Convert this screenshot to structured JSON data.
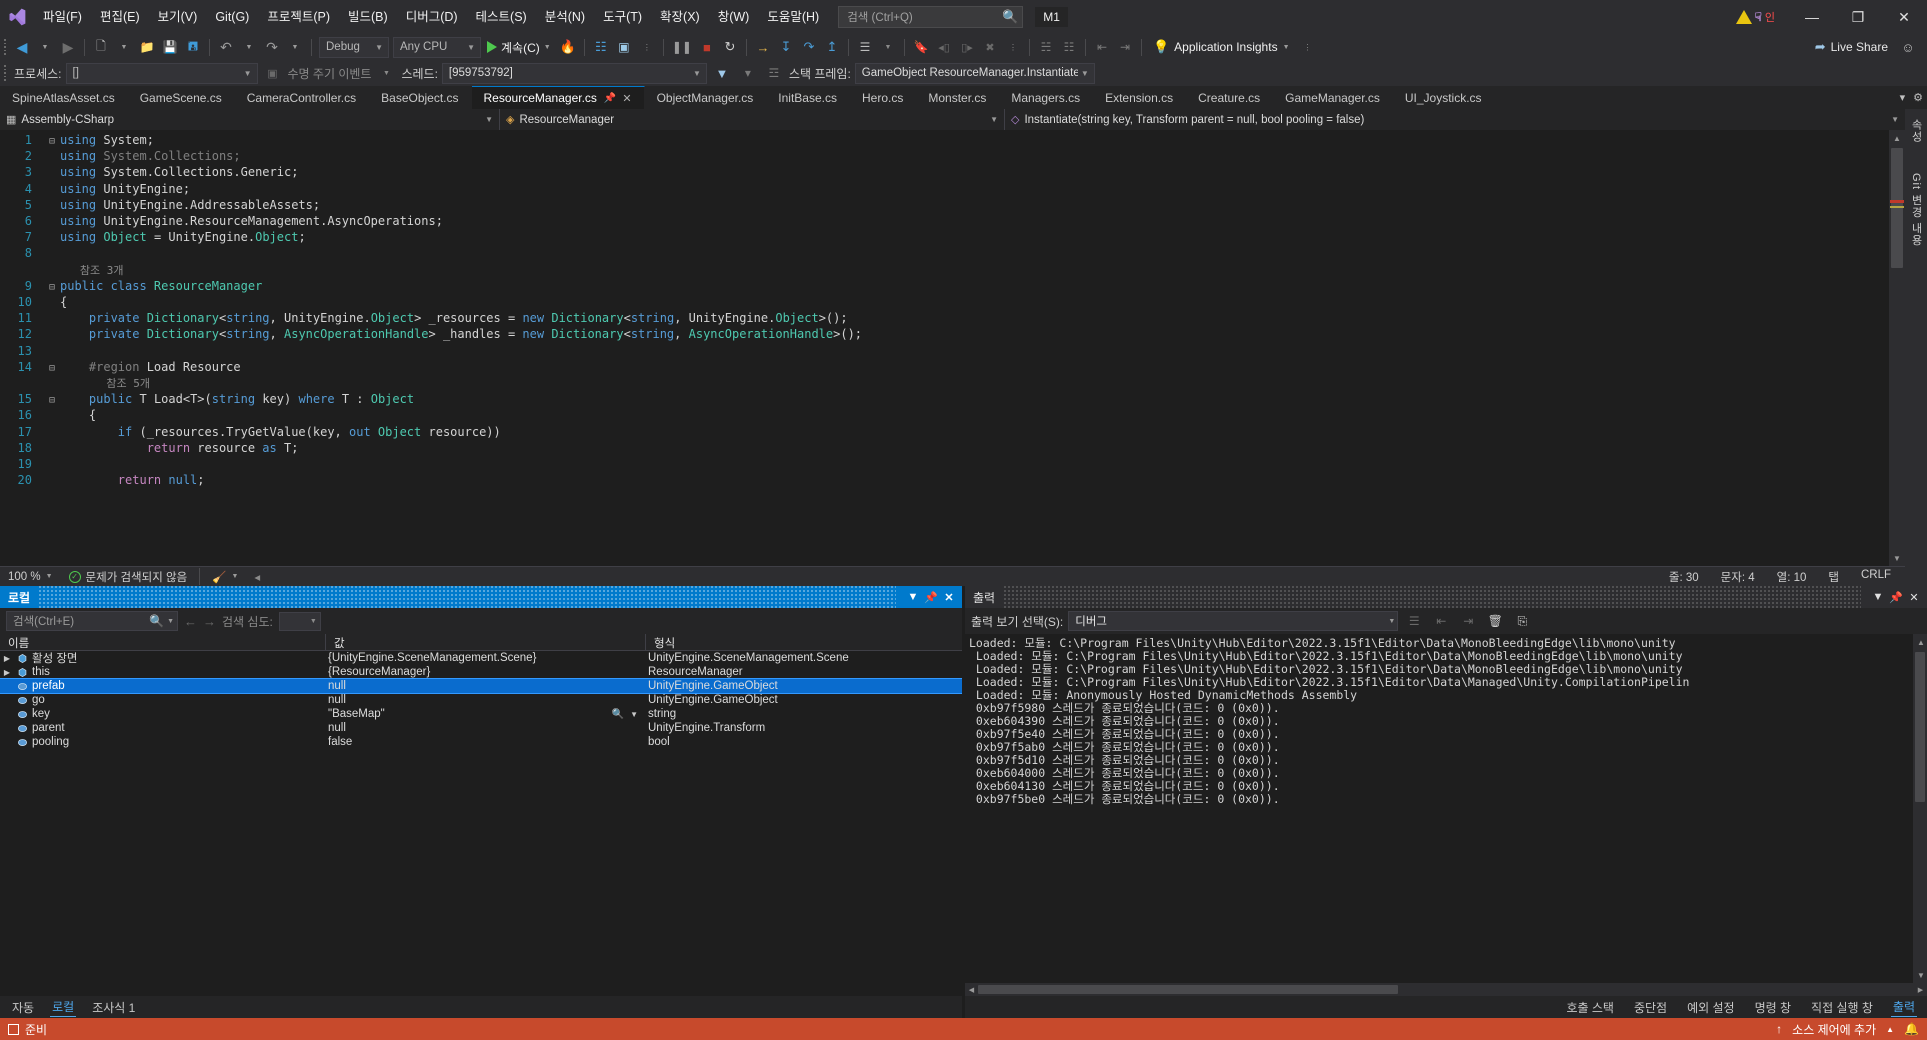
{
  "titlebar": {
    "menus": [
      "파일(F)",
      "편집(E)",
      "보기(V)",
      "Git(G)",
      "프로젝트(P)",
      "빌드(B)",
      "디버그(D)",
      "테스트(S)",
      "분석(N)",
      "도구(T)",
      "확장(X)",
      "창(W)",
      "도움말(H)"
    ],
    "search_placeholder": "검색 (Ctrl+Q)",
    "solution_name": "M1",
    "account_initial": "인",
    "minimize": "—",
    "restore": "❐",
    "close": "✕"
  },
  "toolbar": {
    "back": "◀",
    "forward": "▶",
    "new_item": "新",
    "open": "📂",
    "save": "💾",
    "save_all": "🗇",
    "undo": "↶",
    "redo": "↷",
    "config": "Debug",
    "platform": "Any CPU",
    "run_label": "계속(C)",
    "hot_reload": "🔥",
    "attach": "⛶",
    "screenshot": "◰",
    "pause": "❙❙",
    "stop": "■",
    "restart": "↺",
    "step_over": "→",
    "step_into": "↓",
    "step_out": "↑",
    "show_next": "⇥",
    "threads": "⚏",
    "bookmark": "🔖",
    "insights_label": "Application Insights",
    "live_share": "Live Share"
  },
  "debugbar": {
    "process_label": "프로세스:",
    "process_value": "[]",
    "lifecycle_label": "수명 주기 이벤트",
    "thread_label": "스레드:",
    "thread_value": "[959753792]",
    "stackframe_label": "스택 프레임:",
    "stackframe_value": "GameObject ResourceManager.Instantiate"
  },
  "tabs": [
    {
      "label": "SpineAtlasAsset.cs",
      "active": false
    },
    {
      "label": "GameScene.cs",
      "active": false
    },
    {
      "label": "CameraController.cs",
      "active": false
    },
    {
      "label": "BaseObject.cs",
      "active": false
    },
    {
      "label": "ResourceManager.cs",
      "active": true
    },
    {
      "label": "ObjectManager.cs",
      "active": false
    },
    {
      "label": "InitBase.cs",
      "active": false
    },
    {
      "label": "Hero.cs",
      "active": false
    },
    {
      "label": "Monster.cs",
      "active": false
    },
    {
      "label": "Managers.cs",
      "active": false
    },
    {
      "label": "Extension.cs",
      "active": false
    },
    {
      "label": "Creature.cs",
      "active": false
    },
    {
      "label": "GameManager.cs",
      "active": false
    },
    {
      "label": "UI_Joystick.cs",
      "active": false
    }
  ],
  "navbar": {
    "project": "Assembly-CSharp",
    "type": "ResourceManager",
    "member": "Instantiate(string key, Transform parent = null, bool pooling = false)"
  },
  "editor": {
    "lines": [
      {
        "n": "1",
        "glyph": "⊟",
        "tokens": [
          {
            "t": "using ",
            "c": "kw"
          },
          {
            "t": "System",
            "c": "pun"
          },
          {
            "t": ";",
            "c": "pun"
          }
        ]
      },
      {
        "n": "2",
        "glyph": "",
        "tokens": [
          {
            "t": "using ",
            "c": "kw"
          },
          {
            "t": "System.Collections",
            "c": "gray"
          },
          {
            "t": ";",
            "c": "gray"
          }
        ]
      },
      {
        "n": "3",
        "glyph": "",
        "tokens": [
          {
            "t": "using ",
            "c": "kw"
          },
          {
            "t": "System.Collections.Generic",
            "c": "pun"
          },
          {
            "t": ";",
            "c": "pun"
          }
        ]
      },
      {
        "n": "4",
        "glyph": "",
        "tokens": [
          {
            "t": "using ",
            "c": "kw"
          },
          {
            "t": "UnityEngine",
            "c": "pun"
          },
          {
            "t": ";",
            "c": "pun"
          }
        ]
      },
      {
        "n": "5",
        "glyph": "",
        "tokens": [
          {
            "t": "using ",
            "c": "kw"
          },
          {
            "t": "UnityEngine.AddressableAssets",
            "c": "pun"
          },
          {
            "t": ";",
            "c": "pun"
          }
        ]
      },
      {
        "n": "6",
        "glyph": "",
        "tokens": [
          {
            "t": "using ",
            "c": "kw"
          },
          {
            "t": "UnityEngine.ResourceManagement.AsyncOperations",
            "c": "pun"
          },
          {
            "t": ";",
            "c": "pun"
          }
        ]
      },
      {
        "n": "7",
        "glyph": "",
        "tokens": [
          {
            "t": "using ",
            "c": "kw"
          },
          {
            "t": "Object",
            "c": "typ"
          },
          {
            "t": " = ",
            "c": "pun"
          },
          {
            "t": "UnityEngine.",
            "c": "pun"
          },
          {
            "t": "Object",
            "c": "typ"
          },
          {
            "t": ";",
            "c": "pun"
          }
        ]
      },
      {
        "n": "8",
        "glyph": "",
        "tokens": []
      },
      {
        "n": "",
        "glyph": "",
        "tokens": [
          {
            "t": "   참조 3개",
            "c": "ref"
          }
        ]
      },
      {
        "n": "9",
        "glyph": "⊟",
        "tokens": [
          {
            "t": "public class ",
            "c": "kw"
          },
          {
            "t": "ResourceManager",
            "c": "cls"
          }
        ]
      },
      {
        "n": "10",
        "glyph": "",
        "tokens": [
          {
            "t": "{",
            "c": "pun"
          }
        ]
      },
      {
        "n": "11",
        "glyph": "",
        "tokens": [
          {
            "t": "    private ",
            "c": "kw"
          },
          {
            "t": "Dictionary",
            "c": "typ"
          },
          {
            "t": "<",
            "c": "pun"
          },
          {
            "t": "string",
            "c": "kw"
          },
          {
            "t": ", UnityEngine.",
            "c": "pun"
          },
          {
            "t": "Object",
            "c": "typ"
          },
          {
            "t": "> _resources = ",
            "c": "pun"
          },
          {
            "t": "new ",
            "c": "kw"
          },
          {
            "t": "Dictionary",
            "c": "typ"
          },
          {
            "t": "<",
            "c": "pun"
          },
          {
            "t": "string",
            "c": "kw"
          },
          {
            "t": ", UnityEngine.",
            "c": "pun"
          },
          {
            "t": "Object",
            "c": "typ"
          },
          {
            "t": ">();",
            "c": "pun"
          }
        ]
      },
      {
        "n": "12",
        "glyph": "",
        "tokens": [
          {
            "t": "    private ",
            "c": "kw"
          },
          {
            "t": "Dictionary",
            "c": "typ"
          },
          {
            "t": "<",
            "c": "pun"
          },
          {
            "t": "string",
            "c": "kw"
          },
          {
            "t": ", ",
            "c": "pun"
          },
          {
            "t": "AsyncOperationHandle",
            "c": "typ"
          },
          {
            "t": "> _handles = ",
            "c": "pun"
          },
          {
            "t": "new ",
            "c": "kw"
          },
          {
            "t": "Dictionary",
            "c": "typ"
          },
          {
            "t": "<",
            "c": "pun"
          },
          {
            "t": "string",
            "c": "kw"
          },
          {
            "t": ", ",
            "c": "pun"
          },
          {
            "t": "AsyncOperationHandle",
            "c": "typ"
          },
          {
            "t": ">();",
            "c": "pun"
          }
        ]
      },
      {
        "n": "13",
        "glyph": "",
        "tokens": []
      },
      {
        "n": "14",
        "glyph": "⊟",
        "tokens": [
          {
            "t": "    #region",
            "c": "gray"
          },
          {
            "t": " Load Resource",
            "c": "pun"
          }
        ]
      },
      {
        "n": "",
        "glyph": "",
        "tokens": [
          {
            "t": "       참조 5개",
            "c": "ref"
          }
        ]
      },
      {
        "n": "15",
        "glyph": "⊟",
        "tokens": [
          {
            "t": "    public ",
            "c": "kw"
          },
          {
            "t": "T ",
            "c": "pun"
          },
          {
            "t": "Load",
            "c": "pun"
          },
          {
            "t": "<T>(",
            "c": "pun"
          },
          {
            "t": "string",
            "c": "kw"
          },
          {
            "t": " key) ",
            "c": "pun"
          },
          {
            "t": "where",
            "c": "kw"
          },
          {
            "t": " T : ",
            "c": "pun"
          },
          {
            "t": "Object",
            "c": "typ"
          }
        ]
      },
      {
        "n": "16",
        "glyph": "",
        "tokens": [
          {
            "t": "    {",
            "c": "pun"
          }
        ]
      },
      {
        "n": "17",
        "glyph": "",
        "tokens": [
          {
            "t": "        if",
            "c": "kw"
          },
          {
            "t": " (_resources.TryGetValue(key, ",
            "c": "pun"
          },
          {
            "t": "out ",
            "c": "kw"
          },
          {
            "t": "Object",
            "c": "typ"
          },
          {
            "t": " resource))",
            "c": "pun"
          }
        ]
      },
      {
        "n": "18",
        "glyph": "",
        "tokens": [
          {
            "t": "            return",
            "c": "ctl"
          },
          {
            "t": " resource ",
            "c": "pun"
          },
          {
            "t": "as",
            "c": "kw"
          },
          {
            "t": " T;",
            "c": "pun"
          }
        ]
      },
      {
        "n": "19",
        "glyph": "",
        "tokens": []
      },
      {
        "n": "20",
        "glyph": "",
        "tokens": [
          {
            "t": "        return ",
            "c": "ctl"
          },
          {
            "t": "null",
            "c": "kw"
          },
          {
            "t": ";",
            "c": "pun"
          }
        ]
      }
    ],
    "vtabs": [
      "속성",
      "Git 변경 내용"
    ],
    "status": {
      "zoom": "100 %",
      "issues": "문제가 검색되지 않음",
      "line_label": "줄: 30",
      "col_label": "문자: 4",
      "ch_label": "열: 10",
      "tab_label": "탭",
      "eol": "CRLF"
    }
  },
  "locals": {
    "title": "로컬",
    "search_placeholder": "검색(Ctrl+E)",
    "depth_label": "검색 심도:",
    "depth_value": "",
    "columns": [
      "이름",
      "값",
      "형식"
    ],
    "rows": [
      {
        "expand": "▶",
        "icon": "field",
        "name": "활성 장면",
        "value": "{UnityEngine.SceneManagement.Scene}",
        "type": "UnityEngine.SceneManagement.Scene",
        "selected": false,
        "magnifier": false
      },
      {
        "expand": "▶",
        "icon": "field",
        "name": "this",
        "value": "{ResourceManager}",
        "type": "ResourceManager",
        "selected": false,
        "magnifier": false
      },
      {
        "expand": "",
        "icon": "param",
        "name": "prefab",
        "value": "null",
        "type": "UnityEngine.GameObject",
        "selected": true,
        "magnifier": false
      },
      {
        "expand": "",
        "icon": "param",
        "name": "go",
        "value": "null",
        "type": "UnityEngine.GameObject",
        "selected": false,
        "magnifier": false
      },
      {
        "expand": "",
        "icon": "param",
        "name": "key",
        "value": "\"BaseMap\"",
        "type": "string",
        "selected": false,
        "magnifier": true
      },
      {
        "expand": "",
        "icon": "param",
        "name": "parent",
        "value": "null",
        "type": "UnityEngine.Transform",
        "selected": false,
        "magnifier": false
      },
      {
        "expand": "",
        "icon": "param",
        "name": "pooling",
        "value": "false",
        "type": "bool",
        "selected": false,
        "magnifier": false
      }
    ],
    "bottom_tabs": [
      {
        "label": "자동",
        "active": false
      },
      {
        "label": "로컬",
        "active": true
      },
      {
        "label": "조사식 1",
        "active": false
      }
    ]
  },
  "output": {
    "title": "출력",
    "selector_label": "출력 보기 선택(S):",
    "selector_value": "디버그",
    "log": "Loaded: 모듈: C:\\Program Files\\Unity\\Hub\\Editor\\2022.3.15f1\\Editor\\Data\\MonoBleedingEdge\\lib\\mono\\unity\n Loaded: 모듈: C:\\Program Files\\Unity\\Hub\\Editor\\2022.3.15f1\\Editor\\Data\\MonoBleedingEdge\\lib\\mono\\unity\n Loaded: 모듈: C:\\Program Files\\Unity\\Hub\\Editor\\2022.3.15f1\\Editor\\Data\\MonoBleedingEdge\\lib\\mono\\unity\n Loaded: 모듈: C:\\Program Files\\Unity\\Hub\\Editor\\2022.3.15f1\\Editor\\Data\\Managed\\Unity.CompilationPipelin\n Loaded: 모듈: Anonymously Hosted DynamicMethods Assembly\n 0xb97f5980 스레드가 종료되었습니다(코드: 0 (0x0)).\n 0xeb604390 스레드가 종료되었습니다(코드: 0 (0x0)).\n 0xb97f5e40 스레드가 종료되었습니다(코드: 0 (0x0)).\n 0xb97f5ab0 스레드가 종료되었습니다(코드: 0 (0x0)).\n 0xb97f5d10 스레드가 종료되었습니다(코드: 0 (0x0)).\n 0xeb604000 스레드가 종료되었습니다(코드: 0 (0x0)).\n 0xeb604130 스레드가 종료되었습니다(코드: 0 (0x0)).\n 0xb97f5be0 스레드가 종료되었습니다(코드: 0 (0x0)).",
    "bottom_tabs": [
      {
        "label": "호출 스택",
        "active": false
      },
      {
        "label": "중단점",
        "active": false
      },
      {
        "label": "예외 설정",
        "active": false
      },
      {
        "label": "명령 창",
        "active": false
      },
      {
        "label": "직접 실행 창",
        "active": false
      },
      {
        "label": "출력",
        "active": true
      }
    ]
  },
  "statusbar": {
    "state": "준비",
    "source_control": "소스 제어에 추가",
    "accent": "#c74a2c"
  }
}
